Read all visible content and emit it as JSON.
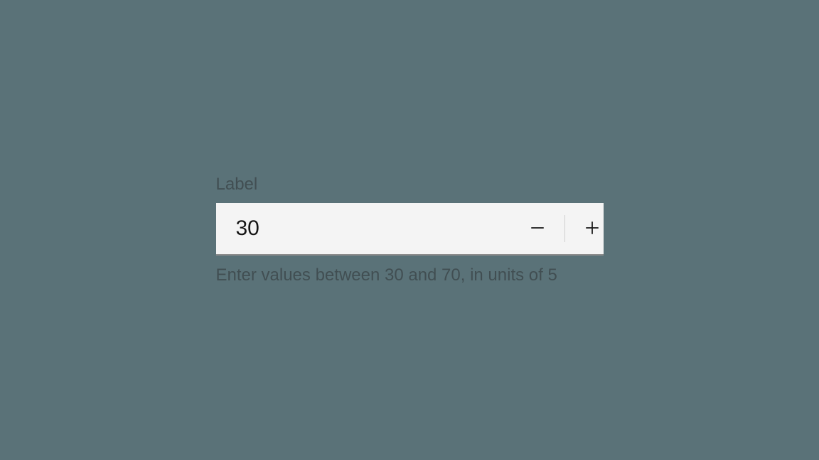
{
  "numberInput": {
    "label": "Label",
    "value": "30",
    "helperText": "Enter values between 30 and 70, in units of 5",
    "min": 30,
    "max": 70,
    "step": 5
  }
}
